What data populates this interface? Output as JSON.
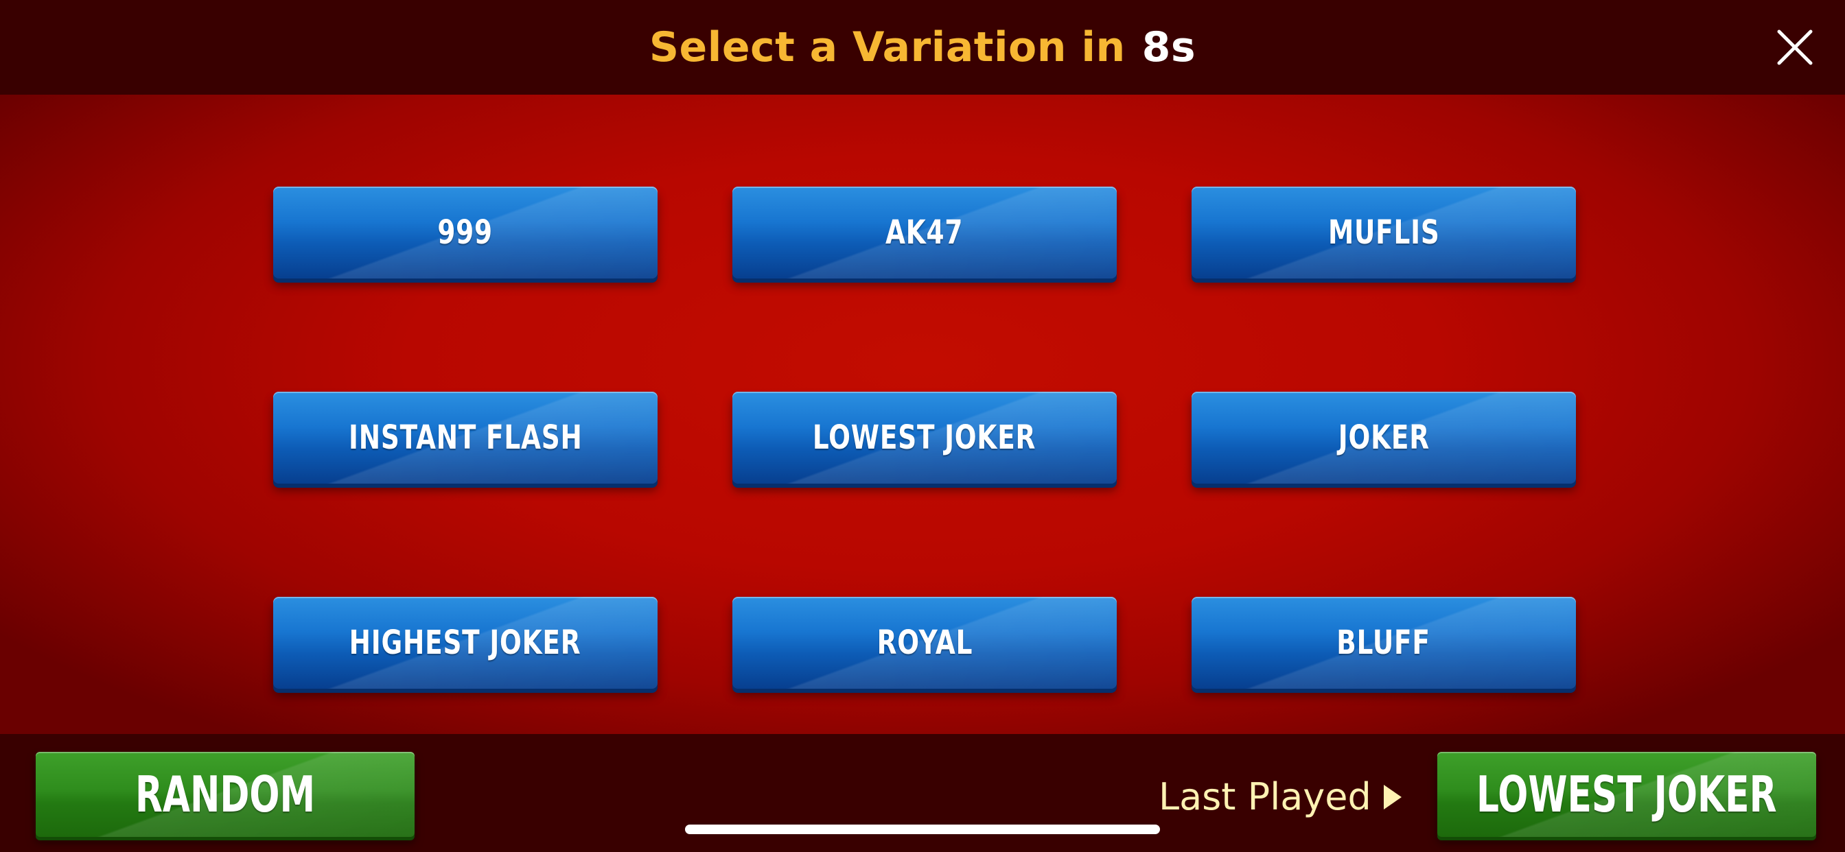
{
  "header": {
    "title_prefix": "Select a Variation in",
    "countdown": "8s",
    "close_icon": "close-icon"
  },
  "variations": [
    "999",
    "AK47",
    "MUFLIS",
    "INSTANT FLASH",
    "LOWEST JOKER",
    "JOKER",
    "HIGHEST JOKER",
    "ROYAL",
    "BLUFF"
  ],
  "footer": {
    "random_label": "RANDOM",
    "last_played_label": "Last Played",
    "last_played_icon": "play-triangle-icon",
    "last_played_value": "LOWEST JOKER"
  },
  "colors": {
    "title": "#f7b733",
    "header_bg": "#390000",
    "felt_red": "#b80700",
    "variation_button": "#1876d1",
    "action_button": "#2f8d1d"
  }
}
